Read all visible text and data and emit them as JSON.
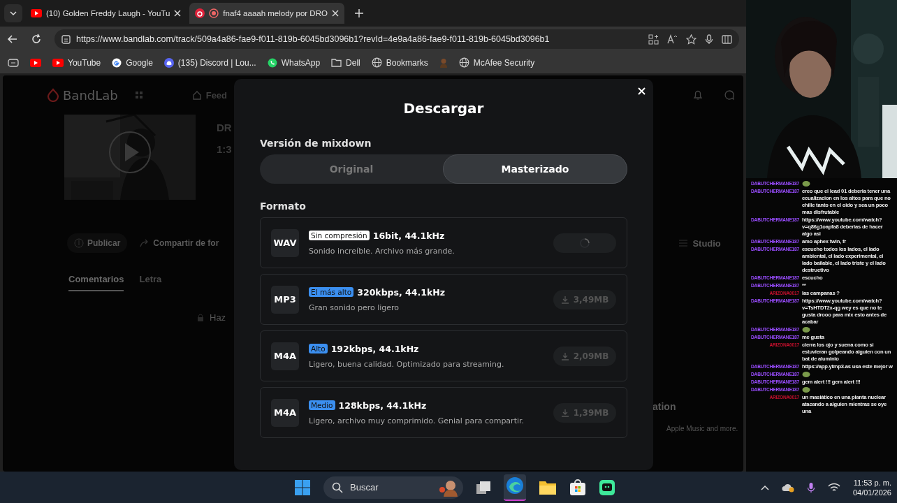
{
  "browser": {
    "tabs": [
      {
        "title": "(10) Golden Freddy Laugh - YouTu",
        "selected": false
      },
      {
        "title": "fnaf4 aaaah melody por DRO",
        "selected": true
      }
    ],
    "url": "https://www.bandlab.com/track/509a4a86-fae9-f011-819b-6045bd3096b1?revId=4e9a4a86-fae9-f011-819b-6045bd3096b1",
    "bookmarks": [
      {
        "kind": "youtube"
      },
      {
        "kind": "youtube",
        "label": "YouTube"
      },
      {
        "kind": "google",
        "label": "Google"
      },
      {
        "kind": "discord",
        "label": "(135) Discord | Lou..."
      },
      {
        "kind": "whatsapp",
        "label": "WhatsApp"
      },
      {
        "kind": "folder",
        "label": "Dell"
      },
      {
        "kind": "globe",
        "label": "Bookmarks"
      },
      {
        "kind": "avatar"
      },
      {
        "kind": "globe",
        "label": "McAfee Security"
      }
    ]
  },
  "page": {
    "logo": "BandLab",
    "nav": "Feed",
    "track_title": "DR",
    "track_time": "1:3",
    "buttons": [
      "Publicar",
      "Compartir de for"
    ],
    "studio": "Studio",
    "tabs": [
      {
        "label": "Comentarios",
        "selected": true
      },
      {
        "label": "Letra",
        "selected": false
      }
    ],
    "comment_hint": "Haz",
    "side_heading": "ation",
    "side_text": "Apple Music and more."
  },
  "modal": {
    "title": "Descargar",
    "mixdown_label": "Versión de mixdown",
    "mixdown_options": [
      {
        "label": "Original",
        "selected": false
      },
      {
        "label": "Masterizado",
        "selected": true
      }
    ],
    "format_label": "Formato",
    "formats": [
      {
        "code": "WAV",
        "badge": "Sin compresión",
        "color": "#ffffff",
        "spec": "16bit, 44.1kHz",
        "description": "Sonido increíble. Archivo más grande.",
        "kind": "loading"
      },
      {
        "code": "MP3",
        "badge": "El más alto",
        "color": "#3b8ff0",
        "spec": "320kbps, 44.1kHz",
        "description": "Gran sonido pero ligero",
        "kind": "download",
        "size": "3,49MB"
      },
      {
        "code": "M4A",
        "badge": "Alto",
        "color": "#3b8ff0",
        "spec": "192kbps, 44.1kHz",
        "description": "Ligero, buena calidad. Optimizado para streaming.",
        "kind": "download",
        "size": "2,09MB"
      },
      {
        "code": "M4A",
        "badge": "Medio",
        "color": "#3b8ff0",
        "spec": "128kbps, 44.1kHz",
        "description": "Ligero, archivo muy comprimido. Genial para compartir.",
        "kind": "download",
        "size": "1,39MB"
      }
    ]
  },
  "chat": [
    {
      "user": "DABUTCHERMANE187",
      "color": "#9a4dff",
      "kind": "emote"
    },
    {
      "user": "DABUTCHERMANE187",
      "color": "#9a4dff",
      "kind": "text",
      "text": "creo que el lead 01 deberia tener una ecualizacion en los altos para que no chille tanto en el oido y sea un poco mas disfrutable"
    },
    {
      "user": "DABUTCHERMANE187",
      "color": "#9a4dff",
      "kind": "text",
      "text": "https://www.youtube.com/watch?v=q86g1oapfa8 deberias de hacer algo asi"
    },
    {
      "user": "DABUTCHERMANE187",
      "color": "#9a4dff",
      "kind": "text",
      "text": "amo aphex twin, fr"
    },
    {
      "user": "DABUTCHERMANE187",
      "color": "#9a4dff",
      "kind": "text",
      "text": "escucho todos los lados, el lado ambiental, el lado experimental, el lado bailable, el lado triste y el lado destructivo"
    },
    {
      "user": "DABUTCHERMANE187",
      "color": "#9a4dff",
      "kind": "text",
      "text": "escucho"
    },
    {
      "user": "DABUTCHERMANE187",
      "color": "#9a4dff",
      "kind": "text",
      "text": "**"
    },
    {
      "user": "ARIZONA0017",
      "color": "#c8102e",
      "kind": "text",
      "text": "las campanas ?"
    },
    {
      "user": "DABUTCHERMANE187",
      "color": "#9a4dff",
      "kind": "text",
      "text": "https://www.youtube.com/watch?v=TsHTDT2x-qg wey es que no te gusta drooo para mix esto antes de acabar"
    },
    {
      "user": "DABUTCHERMANE187",
      "color": "#9a4dff",
      "kind": "emote"
    },
    {
      "user": "DABUTCHERMANE187",
      "color": "#9a4dff",
      "kind": "text",
      "text": "me gusta"
    },
    {
      "user": "ARIZONA0017",
      "color": "#c8102e",
      "kind": "text",
      "text": "cierra los ojo y suena como si estuvieran golpeando alguien con un bat de aluminio"
    },
    {
      "user": "DABUTCHERMANE187",
      "color": "#9a4dff",
      "kind": "text",
      "text": "https://app.ytmp3.as usa este mejor w"
    },
    {
      "user": "DABUTCHERMANE187",
      "color": "#9a4dff",
      "kind": "emote"
    },
    {
      "user": "DABUTCHERMANE187",
      "color": "#9a4dff",
      "kind": "text",
      "text": "gem alert !!! gem alert !!!"
    },
    {
      "user": "DABUTCHERMANE187",
      "color": "#9a4dff",
      "kind": "emote"
    },
    {
      "user": "ARIZONA0017",
      "color": "#c8102e",
      "kind": "text",
      "text": "un masiático en una planta nuclear atacando a alguien mientras se oye una"
    }
  ],
  "taskbar": {
    "search": "Buscar",
    "time": "11:53 p. m.",
    "date": "04/01/2026"
  }
}
